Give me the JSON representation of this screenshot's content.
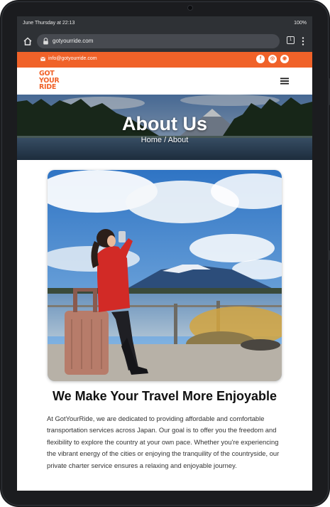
{
  "status_bar": {
    "time": "June Thursday at 22:13",
    "battery": "100%"
  },
  "browser": {
    "url": "gotyourride.com",
    "tab_count": "1"
  },
  "topbar": {
    "email": "info@gotyourride.com",
    "social": [
      "f",
      "◎",
      "◉"
    ]
  },
  "logo": {
    "lines": [
      "GOT",
      "YOUR",
      "RIDE"
    ]
  },
  "hero": {
    "title": "About Us",
    "breadcrumb": "Home / About"
  },
  "content": {
    "title": "We Make Your Travel More Enjoyable",
    "paragraph": "At GotYourRide, we are dedicated to providing affordable and comfortable transportation services across Japan. Our goal is to offer you the freedom and flexibility to explore the country at your own pace. Whether you're experiencing the vibrant energy of the cities or enjoying the tranquility of the countryside, our private charter service ensures a relaxing and enjoyable journey."
  },
  "colors": {
    "brand": "#f06229",
    "browser_chrome": "#2e3135"
  }
}
